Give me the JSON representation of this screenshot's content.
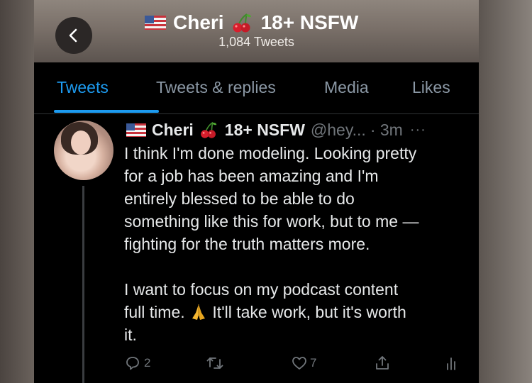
{
  "header": {
    "display_name": "Cheri",
    "badge_text": "18+ NSFW",
    "tweet_count": "1,084 Tweets",
    "back_icon": "chevron-left-icon"
  },
  "tabs": [
    {
      "label": "Tweets",
      "active": true
    },
    {
      "label": "Tweets & replies",
      "active": false
    },
    {
      "label": "Media",
      "active": false
    },
    {
      "label": "Likes",
      "active": false
    }
  ],
  "tweet": {
    "display_name": "Cheri",
    "badge_text": "18+ NSFW",
    "handle": "@hey...",
    "time": "· 3m",
    "more": "···",
    "lines_1": [
      "I think I'm done modeling. Looking pretty",
      "for a job has been amazing and I'm",
      "entirely blessed to be able to do",
      "something like this for work, but to me —",
      "fighting for the truth matters more."
    ],
    "lines_2a": "I want to focus on my podcast content",
    "lines_2b_pre": "full time. ",
    "lines_2b_post": " It'll take work, but it's worth",
    "lines_2c": "it.",
    "emoji": "folded-hands-emoji",
    "reply_count": "2",
    "like_count": "7"
  },
  "colors": {
    "accent": "#1d9bf0",
    "background": "#000000",
    "muted": "#71767b",
    "text": "#e7e9ea"
  }
}
